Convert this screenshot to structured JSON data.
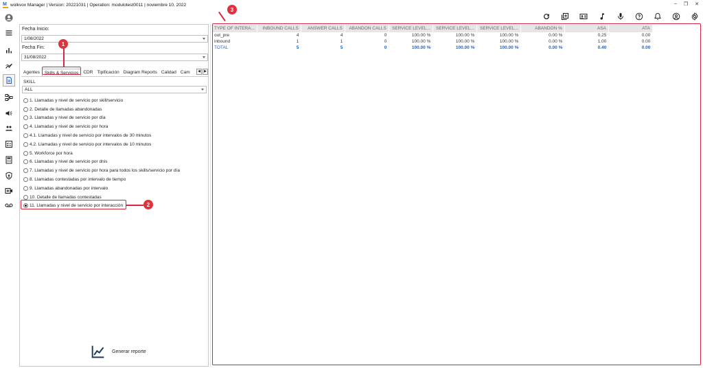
{
  "window": {
    "title": "wolkvox Manager  | Version: 20221031  |  Operation: modulotest0011  |  noviembre 10, 2022",
    "controls": [
      "–",
      "❐",
      "✕"
    ]
  },
  "toolbar": {
    "icons": [
      "refresh-icon",
      "library-add-icon",
      "contact-card-icon",
      "music-note-icon",
      "microphone-icon",
      "help-icon",
      "notification-bell-icon",
      "account-icon",
      "settings-icon"
    ]
  },
  "rail": {
    "icons": [
      "user-avatar-icon",
      "menu-icon",
      "bar-chart-icon",
      "trend-chart-icon",
      "report-doc-icon",
      "flow-diagram-icon",
      "campaign-icon",
      "group-icon",
      "checklist-icon",
      "calculator-icon",
      "shield-icon",
      "video-add-icon",
      "voicemail-icon"
    ]
  },
  "filters": {
    "start_label": "Fecha Inicio:",
    "start_value": "1/08/2022",
    "end_label": "Fecha Fin:",
    "end_value": "31/08/2022"
  },
  "tabs": [
    "Agentes",
    "Skills & Servicios",
    "CDR",
    "Tipificación",
    "Diagram Reports",
    "Calidad",
    "Cam"
  ],
  "skill": {
    "label": "SKILL",
    "value": "ALL"
  },
  "reports": [
    {
      "label": "1. Llamadas y nivel de servicio por skill/servicio",
      "checked": false
    },
    {
      "label": "2. Detalle de llamadas abandonadas",
      "checked": false
    },
    {
      "label": "3. Llamadas y nivel de servicio por día",
      "checked": false
    },
    {
      "label": "4. Llamadas y nivel de servicio por hora",
      "checked": false
    },
    {
      "label": "4.1. Llamadas y nivel de servicio por intervalos de 30 minutos",
      "checked": false
    },
    {
      "label": "4.2. Llamadas y nivel de servicio por intervalos de 10 minutos",
      "checked": false
    },
    {
      "label": "5. Workforce por hora",
      "checked": false
    },
    {
      "label": "6. Llamadas y nivel de servicio por dnis",
      "checked": false
    },
    {
      "label": "7. Llamadas y nivel de servicio por hora para todos los skills/servicio por día",
      "checked": false
    },
    {
      "label": "8. Llamadas contestadas por intervalo de tiempo",
      "checked": false
    },
    {
      "label": "9. Llamadas abandonadas por intervalo",
      "checked": false
    },
    {
      "label": "10. Detalle de llamadas contestadas",
      "checked": false
    },
    {
      "label": "11. Llamadas y nivel de servicio por interacción",
      "checked": true
    }
  ],
  "generate_button": "Generar reporte",
  "table": {
    "columns": [
      "TYPE OF INTERA...",
      "INBOUND CALLS",
      "ANSWER CALLS",
      "ABANDON CALLS",
      "SERVICE LEVEL...",
      "SERVICE LEVEL...",
      "SERVICE LEVEL...",
      "ABANDON %",
      "ASA",
      "ATA"
    ],
    "rows": [
      [
        "out_pre",
        "4",
        "4",
        "0",
        "100.00 %",
        "100.00 %",
        "100.00 %",
        "0.00 %",
        "0.25",
        "0.00"
      ],
      [
        "inbound",
        "1",
        "1",
        "0",
        "100.00 %",
        "100.00 %",
        "100.00 %",
        "0.00 %",
        "1.00",
        "0.00"
      ]
    ],
    "total": [
      "TOTAL",
      "5",
      "5",
      "0",
      "100.00 %",
      "100.00 %",
      "100.00 %",
      "0.00 %",
      "0.40",
      "0.00"
    ]
  },
  "annotations": [
    "1",
    "2",
    "3"
  ],
  "accent_color": "#d7263d"
}
